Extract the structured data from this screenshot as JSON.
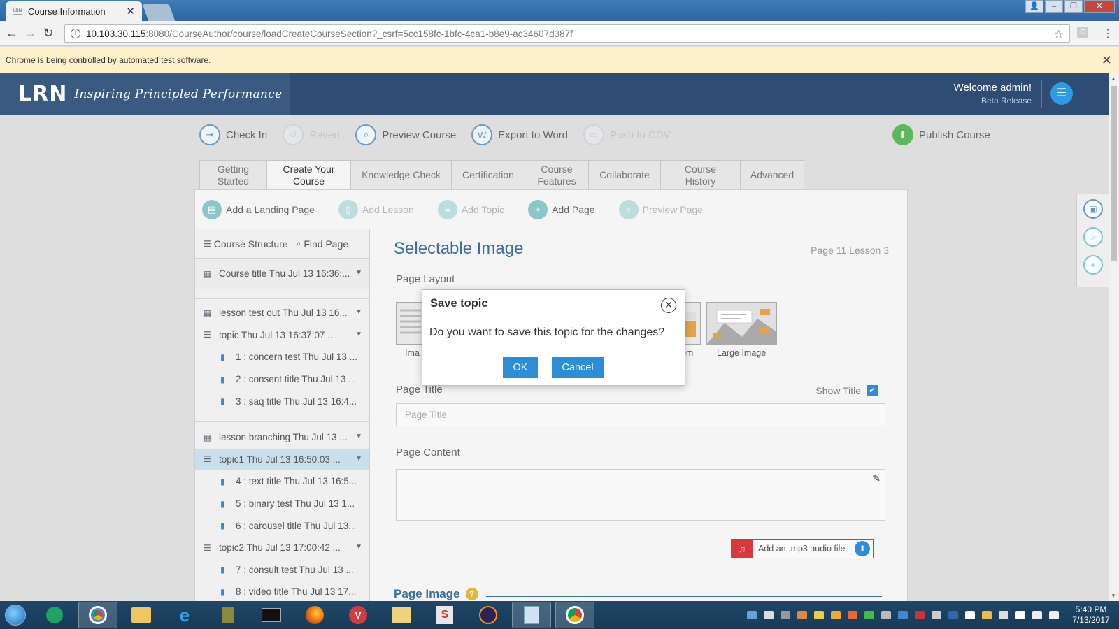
{
  "browser": {
    "tab_title": "Course Information",
    "tab_close": "✕",
    "url_host": "10.103.30.115",
    "url_rest": ":8080/CourseAuthor/course/loadCreateCourseSection?_csrf=5cc158fc-1bfc-4ca1-b8e9-ac34607d387f",
    "infobar_text": "Chrome is being controlled by automated test software."
  },
  "header": {
    "logo_mark": "LRN",
    "logo_tagline": "Inspiring Principled Performance",
    "welcome": "Welcome admin!",
    "release": "Beta Release"
  },
  "toolbar": {
    "items": [
      {
        "label": "Check In",
        "icon": "check-in-icon",
        "enabled": true
      },
      {
        "label": "Revert",
        "icon": "revert-icon",
        "enabled": false
      },
      {
        "label": "Preview Course",
        "icon": "preview-icon",
        "enabled": true
      },
      {
        "label": "Export to Word",
        "icon": "export-word-icon",
        "enabled": true
      },
      {
        "label": "Push to CDV",
        "icon": "push-cdv-icon",
        "enabled": false
      }
    ],
    "publish": "Publish Course"
  },
  "tabs": [
    {
      "label": "Getting Started",
      "active": false
    },
    {
      "label": "Create Your Course",
      "active": true
    },
    {
      "label": "Knowledge Check",
      "active": false
    },
    {
      "label": "Certification",
      "active": false
    },
    {
      "label": "Course Features",
      "active": false
    },
    {
      "label": "Collaborate",
      "active": false
    },
    {
      "label": "Course History",
      "active": false
    },
    {
      "label": "Advanced",
      "active": false
    }
  ],
  "subtoolbar": [
    {
      "label": "Add a Landing Page",
      "enabled": true
    },
    {
      "label": "Add Lesson",
      "enabled": false
    },
    {
      "label": "Add Topic",
      "enabled": false
    },
    {
      "label": "Add Page",
      "enabled": true
    },
    {
      "label": "Preview Page",
      "enabled": false
    }
  ],
  "sidebar": {
    "course_structure": "Course Structure",
    "find_page": "Find Page",
    "course": "Course title Thu Jul 13 16:36:...",
    "lessons": [
      {
        "label": "lesson test out Thu Jul 13 16...",
        "topics": [
          {
            "label": "topic Thu Jul 13 16:37:07 ...",
            "selected": false,
            "pages": [
              "1 : concern test Thu Jul 13 ...",
              "2 : consent title Thu Jul 13 ...",
              "3 : saq title Thu Jul 13 16:4..."
            ]
          }
        ]
      },
      {
        "label": "lesson branching Thu Jul 13 ...",
        "topics": [
          {
            "label": "topic1 Thu Jul 13 16:50:03 ...",
            "selected": true,
            "pages": [
              "4 : text title Thu Jul 13 16:5...",
              "5 : binary test Thu Jul 13 1...",
              "6 : carousel title Thu Jul 13..."
            ]
          },
          {
            "label": "topic2 Thu Jul 13 17:00:42 ...",
            "selected": false,
            "pages": [
              "7 : consult test Thu Jul 13 ...",
              "8 : video title Thu Jul 13 17..."
            ]
          }
        ]
      }
    ]
  },
  "editor": {
    "title": "Selectable Image",
    "meta": "Page 11  Lesson 3",
    "page_layout_label": "Page Layout",
    "layouts": [
      "Ima",
      "ttom",
      "Large Image"
    ],
    "page_title_label": "Page Title",
    "show_title": "Show Title",
    "show_title_checked": true,
    "page_title_placeholder": "Page Title",
    "page_content_label": "Page Content",
    "audio_label": "Add an .mp3 audio file",
    "page_image_label": "Page Image",
    "help": "?"
  },
  "modal": {
    "title": "Save topic",
    "message": "Do you want to save this topic for the changes?",
    "ok": "OK",
    "cancel": "Cancel"
  },
  "taskbar": {
    "time": "5:40 PM",
    "date": "7/13/2017"
  },
  "colors": {
    "brand": "#2f4d74",
    "accent": "#2c8ed8",
    "heading": "#3b6ea3"
  }
}
